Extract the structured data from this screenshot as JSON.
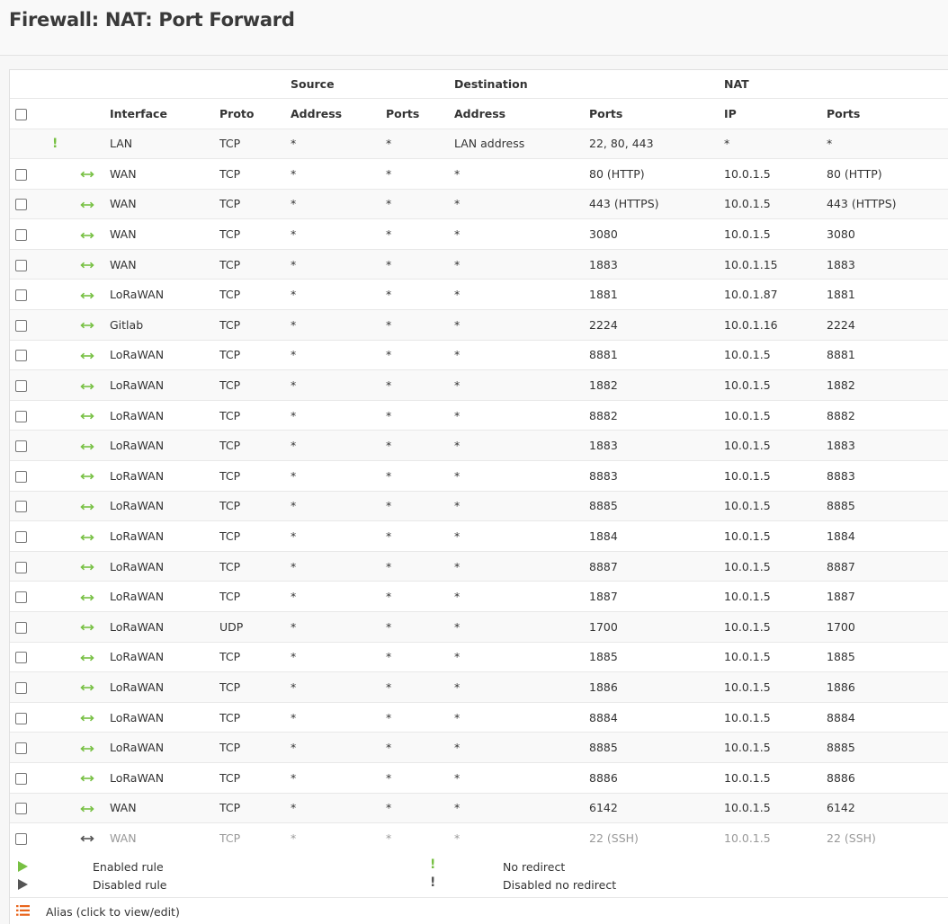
{
  "page": {
    "title": "Firewall: NAT: Port Forward"
  },
  "colors": {
    "enabled": "#77c043",
    "disabled": "#555555",
    "alias": "#e8641b"
  },
  "table": {
    "group_headers": {
      "source": "Source",
      "destination": "Destination",
      "nat": "NAT"
    },
    "columns": {
      "interface": "Interface",
      "proto": "Proto",
      "src_address": "Address",
      "src_ports": "Ports",
      "dst_address": "Address",
      "dst_ports": "Ports",
      "nat_ip": "IP",
      "nat_ports": "Ports"
    },
    "rows": [
      {
        "type": "no-redirect",
        "interface": "LAN",
        "proto": "TCP",
        "src_addr": "*",
        "src_ports": "*",
        "dst_addr": "LAN address",
        "dst_ports": "22, 80, 443",
        "nat_ip": "*",
        "nat_ports": "*"
      },
      {
        "type": "enabled",
        "interface": "WAN",
        "proto": "TCP",
        "src_addr": "*",
        "src_ports": "*",
        "dst_addr": "*",
        "dst_ports": "80 (HTTP)",
        "nat_ip": "10.0.1.5",
        "nat_ports": "80 (HTTP)"
      },
      {
        "type": "enabled",
        "interface": "WAN",
        "proto": "TCP",
        "src_addr": "*",
        "src_ports": "*",
        "dst_addr": "*",
        "dst_ports": "443 (HTTPS)",
        "nat_ip": "10.0.1.5",
        "nat_ports": "443 (HTTPS)"
      },
      {
        "type": "enabled",
        "interface": "WAN",
        "proto": "TCP",
        "src_addr": "*",
        "src_ports": "*",
        "dst_addr": "*",
        "dst_ports": "3080",
        "nat_ip": "10.0.1.5",
        "nat_ports": "3080"
      },
      {
        "type": "enabled",
        "interface": "WAN",
        "proto": "TCP",
        "src_addr": "*",
        "src_ports": "*",
        "dst_addr": "*",
        "dst_ports": "1883",
        "nat_ip": "10.0.1.15",
        "nat_ports": "1883"
      },
      {
        "type": "enabled",
        "interface": "LoRaWAN",
        "proto": "TCP",
        "src_addr": "*",
        "src_ports": "*",
        "dst_addr": "*",
        "dst_ports": "1881",
        "nat_ip": "10.0.1.87",
        "nat_ports": "1881"
      },
      {
        "type": "enabled",
        "interface": "Gitlab",
        "proto": "TCP",
        "src_addr": "*",
        "src_ports": "*",
        "dst_addr": "*",
        "dst_ports": "2224",
        "nat_ip": "10.0.1.16",
        "nat_ports": "2224"
      },
      {
        "type": "enabled",
        "interface": "LoRaWAN",
        "proto": "TCP",
        "src_addr": "*",
        "src_ports": "*",
        "dst_addr": "*",
        "dst_ports": "8881",
        "nat_ip": "10.0.1.5",
        "nat_ports": "8881"
      },
      {
        "type": "enabled",
        "interface": "LoRaWAN",
        "proto": "TCP",
        "src_addr": "*",
        "src_ports": "*",
        "dst_addr": "*",
        "dst_ports": "1882",
        "nat_ip": "10.0.1.5",
        "nat_ports": "1882"
      },
      {
        "type": "enabled",
        "interface": "LoRaWAN",
        "proto": "TCP",
        "src_addr": "*",
        "src_ports": "*",
        "dst_addr": "*",
        "dst_ports": "8882",
        "nat_ip": "10.0.1.5",
        "nat_ports": "8882"
      },
      {
        "type": "enabled",
        "interface": "LoRaWAN",
        "proto": "TCP",
        "src_addr": "*",
        "src_ports": "*",
        "dst_addr": "*",
        "dst_ports": "1883",
        "nat_ip": "10.0.1.5",
        "nat_ports": "1883"
      },
      {
        "type": "enabled",
        "interface": "LoRaWAN",
        "proto": "TCP",
        "src_addr": "*",
        "src_ports": "*",
        "dst_addr": "*",
        "dst_ports": "8883",
        "nat_ip": "10.0.1.5",
        "nat_ports": "8883"
      },
      {
        "type": "enabled",
        "interface": "LoRaWAN",
        "proto": "TCP",
        "src_addr": "*",
        "src_ports": "*",
        "dst_addr": "*",
        "dst_ports": "8885",
        "nat_ip": "10.0.1.5",
        "nat_ports": "8885"
      },
      {
        "type": "enabled",
        "interface": "LoRaWAN",
        "proto": "TCP",
        "src_addr": "*",
        "src_ports": "*",
        "dst_addr": "*",
        "dst_ports": "1884",
        "nat_ip": "10.0.1.5",
        "nat_ports": "1884"
      },
      {
        "type": "enabled",
        "interface": "LoRaWAN",
        "proto": "TCP",
        "src_addr": "*",
        "src_ports": "*",
        "dst_addr": "*",
        "dst_ports": "8887",
        "nat_ip": "10.0.1.5",
        "nat_ports": "8887"
      },
      {
        "type": "enabled",
        "interface": "LoRaWAN",
        "proto": "TCP",
        "src_addr": "*",
        "src_ports": "*",
        "dst_addr": "*",
        "dst_ports": "1887",
        "nat_ip": "10.0.1.5",
        "nat_ports": "1887"
      },
      {
        "type": "enabled",
        "interface": "LoRaWAN",
        "proto": "UDP",
        "src_addr": "*",
        "src_ports": "*",
        "dst_addr": "*",
        "dst_ports": "1700",
        "nat_ip": "10.0.1.5",
        "nat_ports": "1700"
      },
      {
        "type": "enabled",
        "interface": "LoRaWAN",
        "proto": "TCP",
        "src_addr": "*",
        "src_ports": "*",
        "dst_addr": "*",
        "dst_ports": "1885",
        "nat_ip": "10.0.1.5",
        "nat_ports": "1885"
      },
      {
        "type": "enabled",
        "interface": "LoRaWAN",
        "proto": "TCP",
        "src_addr": "*",
        "src_ports": "*",
        "dst_addr": "*",
        "dst_ports": "1886",
        "nat_ip": "10.0.1.5",
        "nat_ports": "1886"
      },
      {
        "type": "enabled",
        "interface": "LoRaWAN",
        "proto": "TCP",
        "src_addr": "*",
        "src_ports": "*",
        "dst_addr": "*",
        "dst_ports": "8884",
        "nat_ip": "10.0.1.5",
        "nat_ports": "8884"
      },
      {
        "type": "enabled",
        "interface": "LoRaWAN",
        "proto": "TCP",
        "src_addr": "*",
        "src_ports": "*",
        "dst_addr": "*",
        "dst_ports": "8885",
        "nat_ip": "10.0.1.5",
        "nat_ports": "8885"
      },
      {
        "type": "enabled",
        "interface": "LoRaWAN",
        "proto": "TCP",
        "src_addr": "*",
        "src_ports": "*",
        "dst_addr": "*",
        "dst_ports": "8886",
        "nat_ip": "10.0.1.5",
        "nat_ports": "8886"
      },
      {
        "type": "enabled",
        "interface": "WAN",
        "proto": "TCP",
        "src_addr": "*",
        "src_ports": "*",
        "dst_addr": "*",
        "dst_ports": "6142",
        "nat_ip": "10.0.1.5",
        "nat_ports": "6142"
      },
      {
        "type": "disabled",
        "interface": "WAN",
        "proto": "TCP",
        "src_addr": "*",
        "src_ports": "*",
        "dst_addr": "*",
        "dst_ports": "22 (SSH)",
        "nat_ip": "10.0.1.5",
        "nat_ports": "22 (SSH)"
      }
    ]
  },
  "legend": {
    "enabled_rule": "Enabled rule",
    "disabled_rule": "Disabled rule",
    "no_redirect": "No redirect",
    "disabled_no_redirect": "Disabled no redirect",
    "alias": "Alias (click to view/edit)"
  }
}
